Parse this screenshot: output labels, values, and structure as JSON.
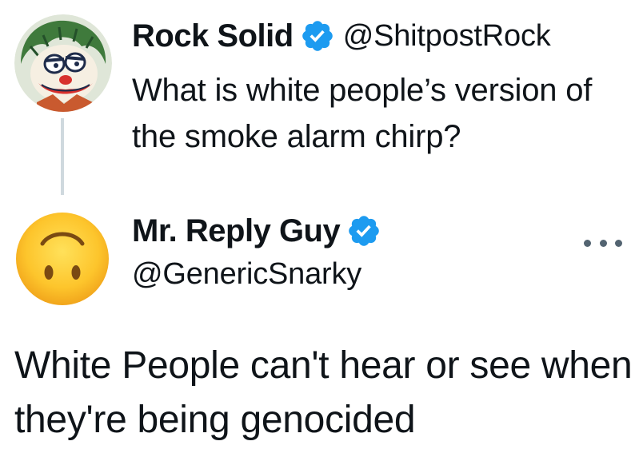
{
  "parent_tweet": {
    "author_name": "Rock Solid",
    "author_handle": "@ShitpostRock",
    "text": "What is white people’s version of the smoke alarm chirp?",
    "verified": true,
    "avatar_icon": "cartoon-clown-avatar-icon"
  },
  "reply_tweet": {
    "author_name": "Mr. Reply Guy",
    "author_handle": "@GenericSnarky",
    "text": "White People can't hear or see when they're being genocided",
    "verified": true,
    "avatar_icon": "upside-down-face-emoji-icon",
    "more_icon": "more-options-icon"
  },
  "colors": {
    "verified_blue": "#1d9bf0",
    "text_primary": "#0f1419",
    "thread_line": "#cfd9de",
    "icon_gray": "#536471"
  }
}
